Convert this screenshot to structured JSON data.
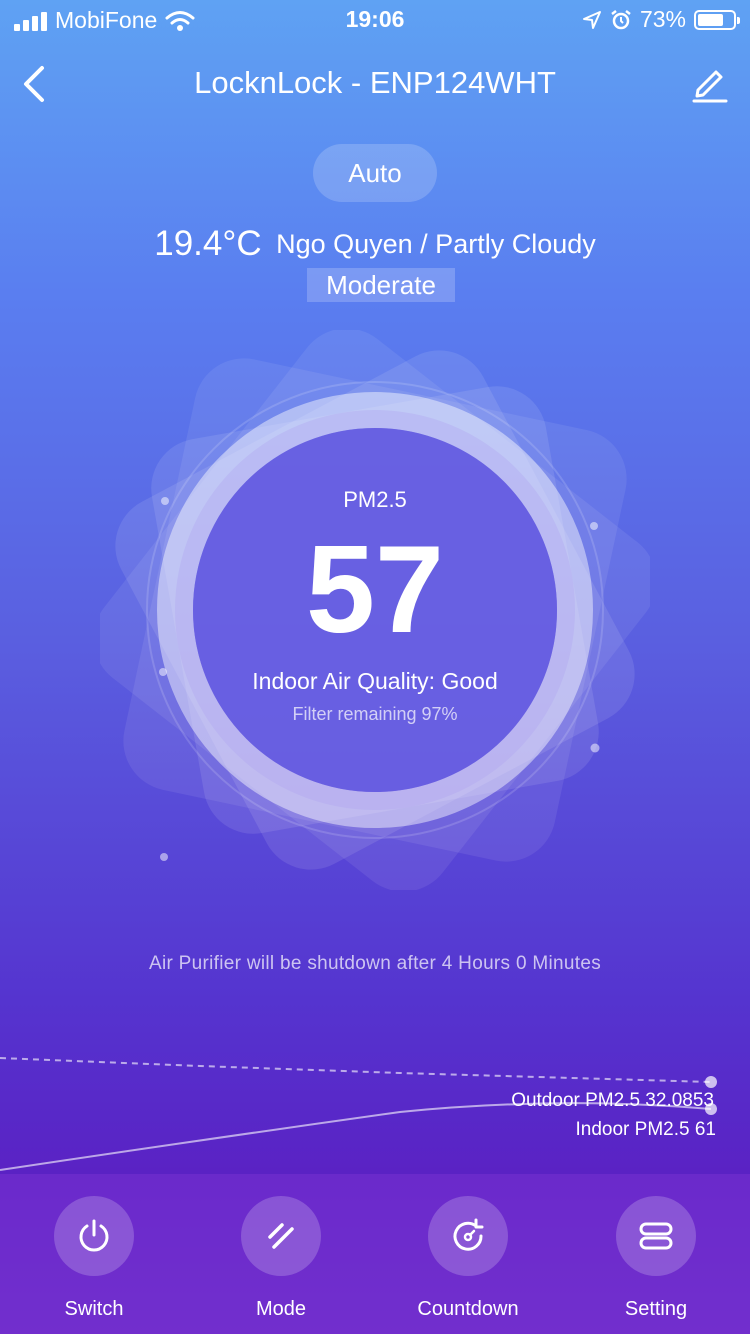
{
  "status_bar": {
    "carrier": "MobiFone",
    "time": "19:06",
    "battery": "73%",
    "battery_level": 0.73
  },
  "header": {
    "title": "LocknLock - ENP124WHT",
    "back_icon": "chevron-left-icon",
    "edit_icon": "pencil-icon"
  },
  "mode": "Auto",
  "weather": {
    "temperature": "19.4°C",
    "location_condition": "Ngo Quyen / Partly Cloudy",
    "air_quality": "Moderate"
  },
  "gauge": {
    "label": "PM2.5",
    "value": "57",
    "indoor_status": "Indoor Air Quality: Good",
    "filter": "Filter remaining 97%"
  },
  "countdown_message": "Air Purifier will be shutdown after 4 Hours 0 Minutes",
  "trend": {
    "outdoor_label": "Outdoor PM2.5 32.0853",
    "indoor_label": "Indoor PM2.5 61"
  },
  "controls": [
    {
      "label": "Switch",
      "icon": "power-icon"
    },
    {
      "label": "Mode",
      "icon": "mode-icon"
    },
    {
      "label": "Countdown",
      "icon": "timer-icon"
    },
    {
      "label": "Setting",
      "icon": "settings-icon"
    }
  ],
  "colors": {
    "gradient_top": "#5fa2f3",
    "gradient_bottom": "#6a2cc8"
  }
}
